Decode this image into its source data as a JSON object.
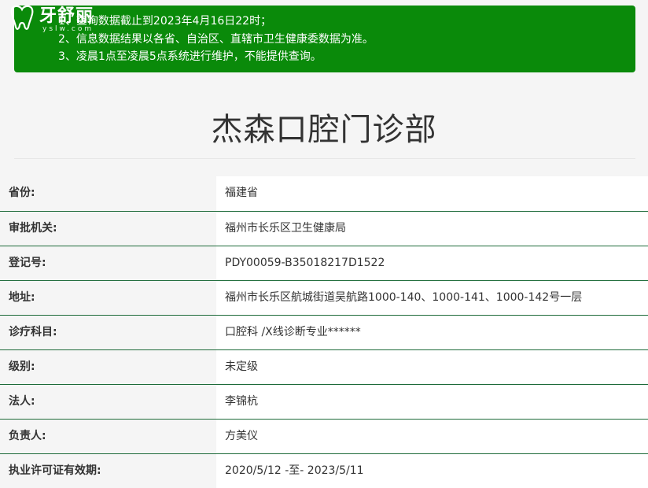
{
  "logo": {
    "name": "牙舒丽",
    "sub": "yslw.com"
  },
  "notice": {
    "lines": [
      "1、查询数据截止到2023年4月16日22时；",
      "2、信息数据结果以各省、自治区、直辖市卫生健康委数据为准。",
      "3、凌晨1点至凌晨5点系统进行维护，不能提供查询。"
    ]
  },
  "page_title": "杰森口腔门诊部",
  "records": [
    {
      "label": "省份:",
      "value": "福建省"
    },
    {
      "label": "审批机关:",
      "value": "福州市长乐区卫生健康局"
    },
    {
      "label": "登记号:",
      "value": "PDY00059-B35018217D1522"
    },
    {
      "label": "地址:",
      "value": "福州市长乐区航城街道吴航路1000-140、1000-141、1000-142号一层"
    },
    {
      "label": "诊疗科目:",
      "value": "口腔科 /X线诊断专业******"
    },
    {
      "label": "级别:",
      "value": "未定级"
    },
    {
      "label": "法人:",
      "value": "李锦杭"
    },
    {
      "label": "负责人:",
      "value": "方美仪"
    },
    {
      "label": "执业许可证有效期:",
      "value": "2020/5/12 -至- 2023/5/11"
    }
  ],
  "colors": {
    "notice_bg": "#0a8a0a",
    "row_divider": "#1e6b3a"
  }
}
